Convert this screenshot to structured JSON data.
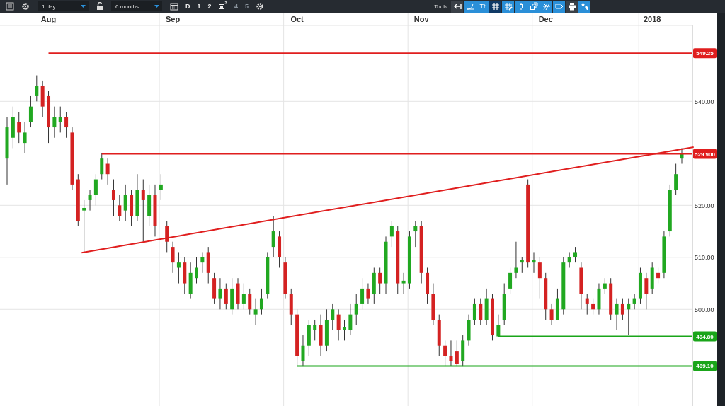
{
  "toolbar": {
    "interval": "1 day",
    "range": "6 months",
    "modes": [
      {
        "kind": "text",
        "label": "D",
        "disabled": false
      },
      {
        "kind": "text",
        "label": "1",
        "disabled": false
      },
      {
        "kind": "text",
        "label": "2",
        "disabled": false
      },
      {
        "kind": "icon",
        "label": "3",
        "disabled": false
      },
      {
        "kind": "text",
        "label": "4",
        "disabled": true
      },
      {
        "kind": "text",
        "label": "5",
        "disabled": true
      }
    ],
    "tools_label": "Tools",
    "tools": [
      {
        "kind": "back",
        "selected": false
      },
      {
        "kind": "curve",
        "selected": false
      },
      {
        "kind": "text",
        "label": "Tt",
        "selected": false
      },
      {
        "kind": "grid",
        "selected": true
      },
      {
        "kind": "pencil",
        "selected": false
      },
      {
        "kind": "candle",
        "selected": false
      },
      {
        "kind": "windows",
        "selected": false
      },
      {
        "kind": "fork",
        "selected": false
      },
      {
        "kind": "tag",
        "selected": false
      },
      {
        "kind": "print",
        "selected": false
      },
      {
        "kind": "wrench",
        "selected": false
      }
    ]
  },
  "chart": {
    "chart_data": {
      "type": "candlestick",
      "categories": [
        null,
        null,
        null,
        null,
        null,
        null,
        null,
        "Aug",
        null,
        null,
        null,
        null,
        null,
        null,
        null,
        null,
        null,
        null,
        null,
        null,
        null,
        null,
        null,
        null,
        null,
        null,
        null,
        null,
        "Sep",
        null,
        null,
        null,
        null,
        null,
        null,
        null,
        null,
        null,
        null,
        null,
        null,
        null,
        null,
        null,
        null,
        null,
        null,
        null,
        null,
        "Oct",
        null,
        null,
        null,
        null,
        null,
        null,
        null,
        null,
        null,
        null,
        null,
        null,
        null,
        null,
        null,
        null,
        null,
        null,
        null,
        null,
        "Nov",
        null,
        null,
        null,
        null,
        null,
        null,
        null,
        null,
        null,
        null,
        null,
        null,
        null,
        null,
        null,
        null,
        null,
        null,
        null,
        null,
        "Dec",
        null,
        null,
        null,
        null,
        null,
        null,
        null,
        null,
        null,
        null,
        null,
        null,
        null,
        null,
        null,
        null,
        null,
        "2018",
        null,
        null,
        null,
        null,
        null
      ],
      "ylim": [
        481.4,
        554.6
      ],
      "grid": true,
      "ref_lines": [
        {
          "axis": "y",
          "value": 549.25,
          "label": "549.25",
          "color": "#e01e1e"
        },
        {
          "axis": "y",
          "value": 529.9,
          "label": "529.900",
          "color": "#e01e1e"
        },
        {
          "axis": "y",
          "value": 494.8,
          "label": "494.80",
          "color": "#1aa51a"
        },
        {
          "axis": "y",
          "value": 489.1,
          "label": "489.10",
          "color": "#1aa51a"
        }
      ],
      "yticks": [
        {
          "value": 500,
          "label": "500.00"
        },
        {
          "value": 510,
          "label": "510.00"
        },
        {
          "value": 520,
          "label": "520.00"
        },
        {
          "value": 540,
          "label": "540.00"
        }
      ],
      "ohlc": [
        [
          529,
          537,
          524,
          535
        ],
        [
          533,
          539,
          531,
          537
        ],
        [
          536,
          538,
          532,
          534
        ],
        [
          532,
          536,
          530,
          534
        ],
        [
          536,
          541,
          535,
          539
        ],
        [
          541,
          545,
          540,
          543
        ],
        [
          543,
          544,
          537,
          539
        ],
        [
          541,
          542,
          532,
          535
        ],
        [
          535,
          539,
          533,
          537
        ],
        [
          536,
          539,
          534,
          537
        ],
        [
          537,
          538,
          533,
          535
        ],
        [
          534,
          535,
          523,
          524
        ],
        [
          525,
          526,
          516,
          517
        ],
        [
          519,
          521,
          511,
          519.5
        ],
        [
          521,
          523,
          519,
          522
        ],
        [
          522,
          526,
          520,
          525
        ],
        [
          526,
          530,
          525,
          529
        ],
        [
          528,
          529,
          524,
          526
        ],
        [
          523,
          525,
          518,
          521
        ],
        [
          520,
          522,
          517,
          518
        ],
        [
          519,
          524,
          517,
          522
        ],
        [
          522,
          523,
          516,
          518
        ],
        [
          518,
          526,
          517,
          523
        ],
        [
          523,
          525,
          513,
          521
        ],
        [
          518,
          524,
          516,
          522
        ],
        [
          522,
          524,
          514,
          516
        ],
        [
          523,
          526,
          521,
          524
        ],
        [
          516,
          517,
          511,
          513
        ],
        [
          512,
          513,
          507,
          509
        ],
        [
          508,
          511,
          505,
          509
        ],
        [
          509,
          510,
          503,
          505
        ],
        [
          503,
          509,
          502,
          507
        ],
        [
          506,
          510,
          505,
          508
        ],
        [
          509,
          511,
          507,
          510
        ],
        [
          511,
          512,
          505,
          507
        ],
        [
          506,
          507,
          501,
          502
        ],
        [
          502,
          506,
          500,
          504
        ],
        [
          504,
          505,
          500,
          501
        ],
        [
          500,
          506,
          499,
          504
        ],
        [
          505,
          506,
          500,
          501
        ],
        [
          501,
          505,
          500,
          503
        ],
        [
          503,
          504,
          499,
          500
        ],
        [
          499,
          502,
          497,
          500
        ],
        [
          500,
          504,
          499,
          502
        ],
        [
          503,
          511,
          502,
          510
        ],
        [
          512,
          518,
          510,
          515
        ],
        [
          514,
          515,
          508,
          510
        ],
        [
          509,
          510,
          502,
          503
        ],
        [
          503,
          504,
          497,
          499
        ],
        [
          499,
          500,
          489.1,
          491
        ],
        [
          490,
          495,
          489,
          493
        ],
        [
          493,
          498,
          491,
          497
        ],
        [
          496,
          498,
          494,
          497
        ],
        [
          497,
          499,
          491,
          493
        ],
        [
          493,
          500,
          492,
          498
        ],
        [
          498,
          501,
          496,
          500
        ],
        [
          499,
          500,
          494,
          496
        ],
        [
          496,
          498,
          494,
          496.5
        ],
        [
          496,
          501,
          495,
          499
        ],
        [
          499,
          503,
          497,
          501
        ],
        [
          501,
          506,
          500,
          504
        ],
        [
          504,
          505,
          501,
          502
        ],
        [
          503,
          508,
          501,
          507
        ],
        [
          507,
          508,
          503,
          505
        ],
        [
          505,
          514,
          503,
          513
        ],
        [
          514,
          517,
          512,
          516
        ],
        [
          515,
          516,
          503,
          505
        ],
        [
          505,
          507,
          503,
          505.5
        ],
        [
          505,
          515,
          504,
          514
        ],
        [
          515,
          517,
          512,
          516
        ],
        [
          516,
          517,
          505,
          507
        ],
        [
          507,
          508,
          501,
          503
        ],
        [
          503,
          505,
          497,
          498
        ],
        [
          498,
          499,
          491,
          493
        ],
        [
          493,
          494,
          489,
          491
        ],
        [
          491,
          494,
          489.1,
          490
        ],
        [
          492,
          494,
          489,
          489.5
        ],
        [
          490,
          495,
          489,
          494
        ],
        [
          494,
          499,
          493,
          498
        ],
        [
          498,
          502,
          497,
          501
        ],
        [
          501,
          502,
          497,
          498
        ],
        [
          498,
          504,
          497,
          502
        ],
        [
          502,
          503,
          494,
          495
        ],
        [
          494.8,
          499,
          494.8,
          497
        ],
        [
          498,
          505,
          497,
          503
        ],
        [
          504,
          508,
          503,
          507
        ],
        [
          507,
          513,
          506,
          508
        ],
        [
          509,
          510,
          507,
          509.5
        ],
        [
          524,
          525,
          508,
          509
        ],
        [
          509,
          511,
          507,
          509.5
        ],
        [
          509,
          510,
          502,
          506
        ],
        [
          506,
          507,
          498,
          500
        ],
        [
          500,
          501,
          497,
          498
        ],
        [
          498,
          504,
          498,
          502
        ],
        [
          500,
          510,
          499,
          509
        ],
        [
          509,
          511,
          508,
          510
        ],
        [
          510,
          512,
          509,
          511
        ],
        [
          508,
          509,
          500,
          503
        ],
        [
          502,
          503,
          499,
          501
        ],
        [
          501,
          502,
          499,
          500
        ],
        [
          500,
          505,
          499,
          504
        ],
        [
          504,
          506,
          503,
          505
        ],
        [
          505,
          506,
          498,
          499
        ],
        [
          499,
          502,
          496,
          501
        ],
        [
          501,
          502,
          498,
          499
        ],
        [
          500,
          502,
          495,
          501
        ],
        [
          501,
          503,
          500,
          502
        ],
        [
          502,
          508,
          501,
          507
        ],
        [
          506,
          507,
          500,
          503
        ],
        [
          504,
          509,
          503,
          508
        ],
        [
          507,
          508,
          505,
          506
        ],
        [
          507,
          515,
          506,
          514
        ],
        [
          515,
          524,
          514,
          523
        ],
        [
          523,
          528,
          522,
          526
        ],
        [
          529,
          531,
          528,
          530
        ]
      ]
    }
  }
}
